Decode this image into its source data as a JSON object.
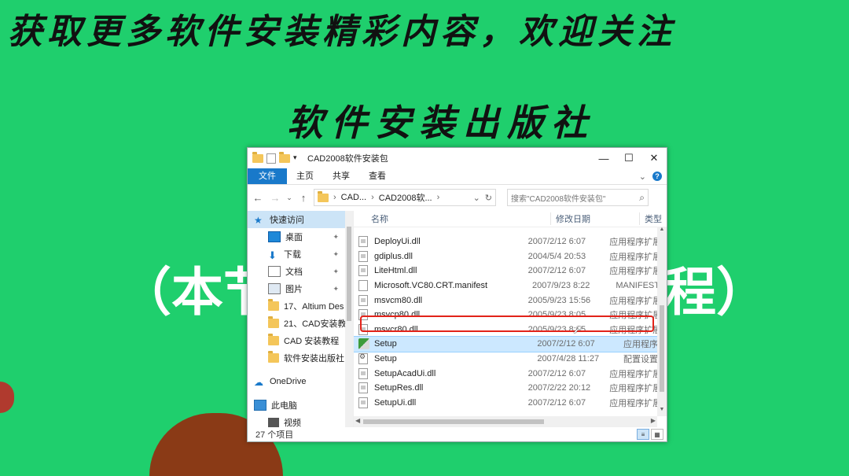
{
  "banner": {
    "line1": "获取更多软件安装精彩内容，欢迎关注",
    "line2": "软件安装出版社",
    "lesson_left": "（本节",
    "lesson_right": "程）"
  },
  "window": {
    "title": "CAD2008软件安装包",
    "buttons": {
      "minimize": "—",
      "maximize": "☐",
      "close": "✕"
    },
    "ribbon_tabs": [
      "文件",
      "主页",
      "共享",
      "查看"
    ],
    "help": "?",
    "expand": "⌄"
  },
  "address": {
    "back": "←",
    "forward": "→",
    "recent": "⌄",
    "up": "↑",
    "crumbs": [
      "CAD...",
      "CAD2008软..."
    ],
    "separator": "›",
    "dropdown": "⌄",
    "refresh": "↻",
    "search_placeholder": "搜索\"CAD2008软件安装包\"",
    "search_icon": "⌕"
  },
  "nav": {
    "quick_access": "快速访问",
    "items": [
      {
        "label": "桌面",
        "icon": "desktop-icon",
        "pinned": true
      },
      {
        "label": "下载",
        "icon": "download-icon",
        "pinned": true
      },
      {
        "label": "文档",
        "icon": "document-icon",
        "pinned": true
      },
      {
        "label": "图片",
        "icon": "picture-icon",
        "pinned": true
      },
      {
        "label": "17、Altium Des",
        "icon": "folder-icon",
        "pinned": false
      },
      {
        "label": "21、CAD安装教",
        "icon": "folder-icon",
        "pinned": false
      },
      {
        "label": "CAD 安装教程",
        "icon": "folder-icon",
        "pinned": false
      },
      {
        "label": "软件安装出版社",
        "icon": "folder-icon",
        "pinned": false
      }
    ],
    "pin_glyph": "✦",
    "onedrive": "OneDrive",
    "this_pc": "此电脑",
    "video": "视频"
  },
  "columns": {
    "name": "名称",
    "date": "修改日期",
    "type": "类型",
    "sort_glyph": "^"
  },
  "files": [
    {
      "name": "DeployUi.dll",
      "date": "2007/2/12 6:07",
      "type": "应用程序扩展",
      "kind": "dll"
    },
    {
      "name": "gdiplus.dll",
      "date": "2004/5/4 20:53",
      "type": "应用程序扩展",
      "kind": "dll"
    },
    {
      "name": "LiteHtml.dll",
      "date": "2007/2/12 6:07",
      "type": "应用程序扩展",
      "kind": "dll"
    },
    {
      "name": "Microsoft.VC80.CRT.manifest",
      "date": "2007/9/23 8:22",
      "type": "MANIFEST",
      "kind": "file"
    },
    {
      "name": "msvcm80.dll",
      "date": "2005/9/23 15:56",
      "type": "应用程序扩展",
      "kind": "dll"
    },
    {
      "name": "msvcp80.dll",
      "date": "2005/9/23 8:05",
      "type": "应用程序扩展",
      "kind": "dll"
    },
    {
      "name": "msvcr80.dll",
      "date": "2005/9/23 8:05",
      "type": "应用程序扩展",
      "kind": "dll"
    },
    {
      "name": "Setup",
      "date": "2007/2/12 6:07",
      "type": "应用程序",
      "kind": "setup"
    },
    {
      "name": "Setup",
      "date": "2007/4/28 11:27",
      "type": "配置设置",
      "kind": "cfg"
    },
    {
      "name": "SetupAcadUi.dll",
      "date": "2007/2/12 6:07",
      "type": "应用程序扩展",
      "kind": "dll"
    },
    {
      "name": "SetupRes.dll",
      "date": "2007/2/22 20:12",
      "type": "应用程序扩展",
      "kind": "dll"
    },
    {
      "name": "SetupUi.dll",
      "date": "2007/2/12 6:07",
      "type": "应用程序扩展",
      "kind": "dll"
    }
  ],
  "status": {
    "count": "27 个项目"
  }
}
